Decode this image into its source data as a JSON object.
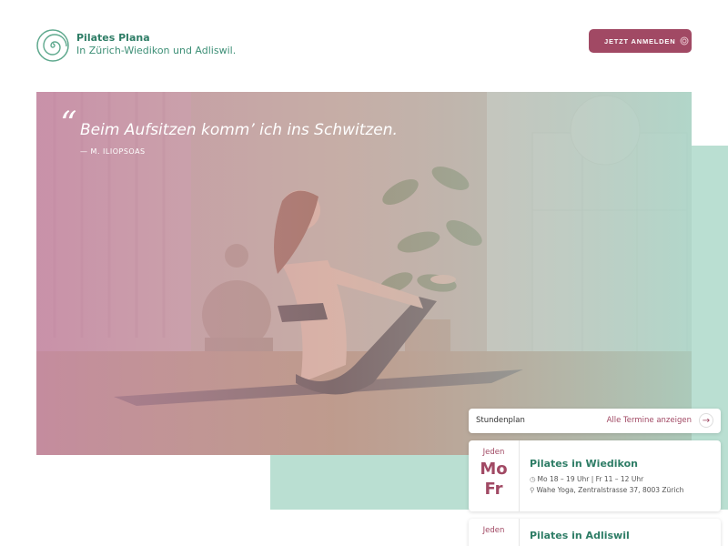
{
  "header": {
    "brand_name": "Pilates Plana",
    "brand_tagline": "In Zürich-Wiedikon und Adliswil.",
    "cta_label": "JETZT ANMELDEN"
  },
  "hero": {
    "quote_mark": "“",
    "quote": "Beim Aufsitzen komm’ ich ins Schwitzen.",
    "author": "— M. ILIOPSOAS"
  },
  "schedule": {
    "title": "Stundenplan",
    "link_label": "Alle Termine anzeigen",
    "arrow": "→",
    "cards": [
      {
        "prefix": "Jeden",
        "day1": "Mo",
        "day2": "Fr",
        "title": "Pilates in Wiedikon",
        "time": "Mo 18 – 19 Uhr | Fr 11 – 12 Uhr",
        "address": "Wahe Yoga, Zentralstrasse 37, 8003 Zürich"
      },
      {
        "prefix": "Jeden",
        "title": "Pilates in Adliswil"
      }
    ]
  },
  "colors": {
    "primary_green": "#2e7d66",
    "accent_berry": "#a14964",
    "mint": "#a3d4c3"
  },
  "icons": {
    "logo": "spiral-logo-icon",
    "cta": "spiral-ring-icon",
    "time": "clock-icon",
    "address": "map-pin-icon",
    "link": "arrow-right-icon"
  }
}
